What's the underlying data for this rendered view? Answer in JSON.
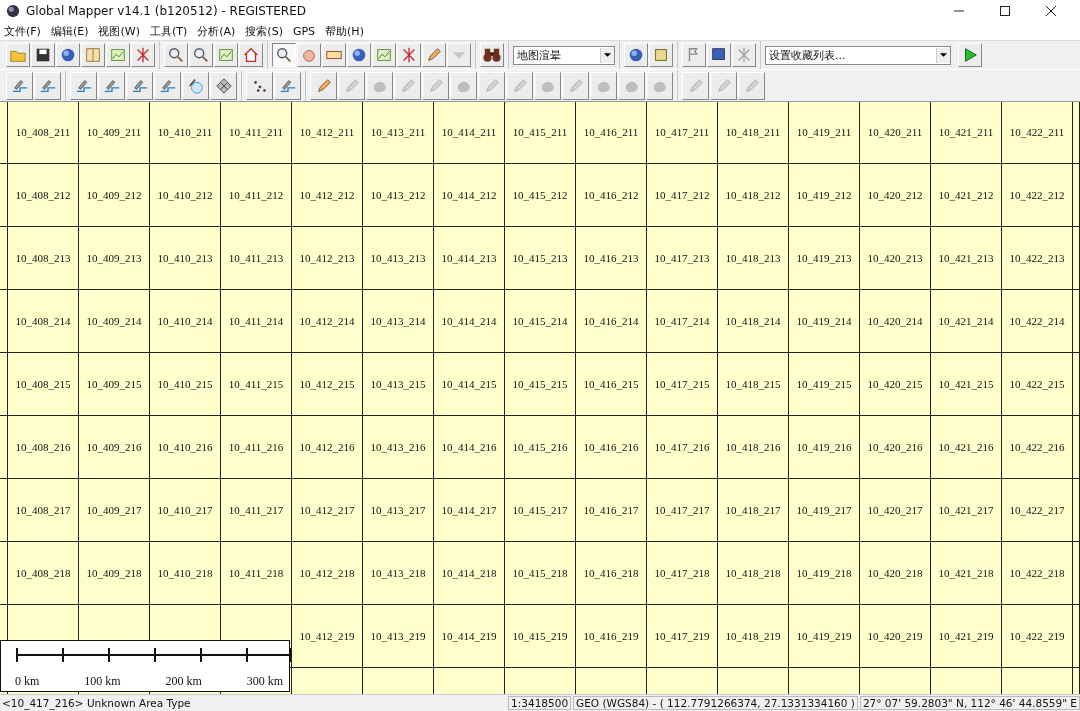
{
  "window": {
    "title": "Global Mapper v14.1 (b120512) - REGISTERED"
  },
  "menu": [
    "文件(F)",
    "编辑(E)",
    "视图(W)",
    "工具(T)",
    "分析(A)",
    "搜索(S)",
    "GPS",
    "帮助(H)"
  ],
  "toolbar_1": {
    "groups": [
      {
        "buttons": [
          {
            "disabled": false,
            "pressed": false
          },
          {
            "disabled": false,
            "pressed": false
          },
          {
            "disabled": false,
            "pressed": false
          },
          {
            "disabled": false,
            "pressed": false
          },
          {
            "disabled": false,
            "pressed": false
          },
          {
            "disabled": false,
            "pressed": false
          }
        ]
      },
      {
        "buttons": [
          {
            "disabled": false,
            "pressed": false
          },
          {
            "disabled": false,
            "pressed": false
          },
          {
            "disabled": false,
            "pressed": false
          },
          {
            "disabled": false,
            "pressed": false
          }
        ]
      },
      {
        "buttons": [
          {
            "disabled": false,
            "pressed": true
          },
          {
            "disabled": false,
            "pressed": false
          },
          {
            "disabled": false,
            "pressed": false
          },
          {
            "disabled": false,
            "pressed": false
          },
          {
            "disabled": false,
            "pressed": false
          },
          {
            "disabled": false,
            "pressed": false
          },
          {
            "disabled": false,
            "pressed": false
          },
          {
            "disabled": true,
            "pressed": false
          }
        ]
      },
      {
        "buttons": [
          {
            "disabled": false,
            "pressed": false
          }
        ]
      }
    ],
    "map_combo": {
      "value": "地图渲晕"
    },
    "groups_2": [
      {
        "buttons": [
          {
            "disabled": false,
            "pressed": false
          },
          {
            "disabled": false,
            "pressed": false
          }
        ]
      },
      {
        "buttons": [
          {
            "disabled": false,
            "pressed": false
          },
          {
            "disabled": false,
            "pressed": false
          },
          {
            "disabled": true,
            "pressed": false
          }
        ]
      }
    ],
    "favorites_combo": {
      "value": "设置收藏列表..."
    }
  },
  "toolbar_2": {
    "groups": [
      {
        "buttons": [
          {
            "disabled": false
          },
          {
            "disabled": false
          }
        ]
      },
      {
        "buttons": [
          {
            "disabled": false
          },
          {
            "disabled": false
          },
          {
            "disabled": false
          },
          {
            "disabled": false
          },
          {
            "disabled": false
          },
          {
            "disabled": false
          }
        ]
      },
      {
        "buttons": [
          {
            "disabled": false
          },
          {
            "disabled": false
          }
        ]
      },
      {
        "buttons": [
          {
            "disabled": false
          },
          {
            "disabled": true
          },
          {
            "disabled": true
          },
          {
            "disabled": true
          },
          {
            "disabled": true
          },
          {
            "disabled": true
          },
          {
            "disabled": true
          },
          {
            "disabled": true
          },
          {
            "disabled": true
          },
          {
            "disabled": true
          },
          {
            "disabled": true
          },
          {
            "disabled": true
          },
          {
            "disabled": true
          }
        ]
      },
      {
        "buttons": [
          {
            "disabled": true
          },
          {
            "disabled": true
          },
          {
            "disabled": true
          }
        ]
      }
    ]
  },
  "map": {
    "rows": [
      [
        "10_408_211",
        "10_409_211",
        "10_410_211",
        "10_411_211",
        "10_412_211",
        "10_413_211",
        "10_414_211",
        "10_415_211",
        "10_416_211",
        "10_417_211",
        "10_418_211",
        "10_419_211",
        "10_420_211",
        "10_421_211",
        "10_422_211"
      ],
      [
        "10_408_212",
        "10_409_212",
        "10_410_212",
        "10_411_212",
        "10_412_212",
        "10_413_212",
        "10_414_212",
        "10_415_212",
        "10_416_212",
        "10_417_212",
        "10_418_212",
        "10_419_212",
        "10_420_212",
        "10_421_212",
        "10_422_212"
      ],
      [
        "10_408_213",
        "10_409_213",
        "10_410_213",
        "10_411_213",
        "10_412_213",
        "10_413_213",
        "10_414_213",
        "10_415_213",
        "10_416_213",
        "10_417_213",
        "10_418_213",
        "10_419_213",
        "10_420_213",
        "10_421_213",
        "10_422_213"
      ],
      [
        "10_408_214",
        "10_409_214",
        "10_410_214",
        "10_411_214",
        "10_412_214",
        "10_413_214",
        "10_414_214",
        "10_415_214",
        "10_416_214",
        "10_417_214",
        "10_418_214",
        "10_419_214",
        "10_420_214",
        "10_421_214",
        "10_422_214"
      ],
      [
        "10_408_215",
        "10_409_215",
        "10_410_215",
        "10_411_215",
        "10_412_215",
        "10_413_215",
        "10_414_215",
        "10_415_215",
        "10_416_215",
        "10_417_215",
        "10_418_215",
        "10_419_215",
        "10_420_215",
        "10_421_215",
        "10_422_215"
      ],
      [
        "10_408_216",
        "10_409_216",
        "10_410_216",
        "10_411_216",
        "10_412_216",
        "10_413_216",
        "10_414_216",
        "10_415_216",
        "10_416_216",
        "10_417_216",
        "10_418_216",
        "10_419_216",
        "10_420_216",
        "10_421_216",
        "10_422_216"
      ],
      [
        "10_408_217",
        "10_409_217",
        "10_410_217",
        "10_411_217",
        "10_412_217",
        "10_413_217",
        "10_414_217",
        "10_415_217",
        "10_416_217",
        "10_417_217",
        "10_418_217",
        "10_419_217",
        "10_420_217",
        "10_421_217",
        "10_422_217"
      ],
      [
        "10_408_218",
        "10_409_218",
        "10_410_218",
        "10_411_218",
        "10_412_218",
        "10_413_218",
        "10_414_218",
        "10_415_218",
        "10_416_218",
        "10_417_218",
        "10_418_218",
        "10_419_218",
        "10_420_218",
        "10_421_218",
        "10_422_218"
      ],
      [
        null,
        null,
        null,
        null,
        "10_412_219",
        "10_413_219",
        "10_414_219",
        "10_415_219",
        "10_416_219",
        "10_417_219",
        "10_418_219",
        "10_419_219",
        "10_420_219",
        "10_421_219",
        "10_422_219"
      ]
    ],
    "scale_bar": {
      "labels": [
        "0 km",
        "100 km",
        "200 km",
        "300 km"
      ]
    }
  },
  "status_bar": [
    "<10_417_216> Unknown Area Type",
    "1:3418500",
    "GEO (WGS84) - ( 112.7791266374, 27.1331334160 )",
    "27° 07' 59.2803\" N, 112° 46' 44.8559\" E"
  ]
}
